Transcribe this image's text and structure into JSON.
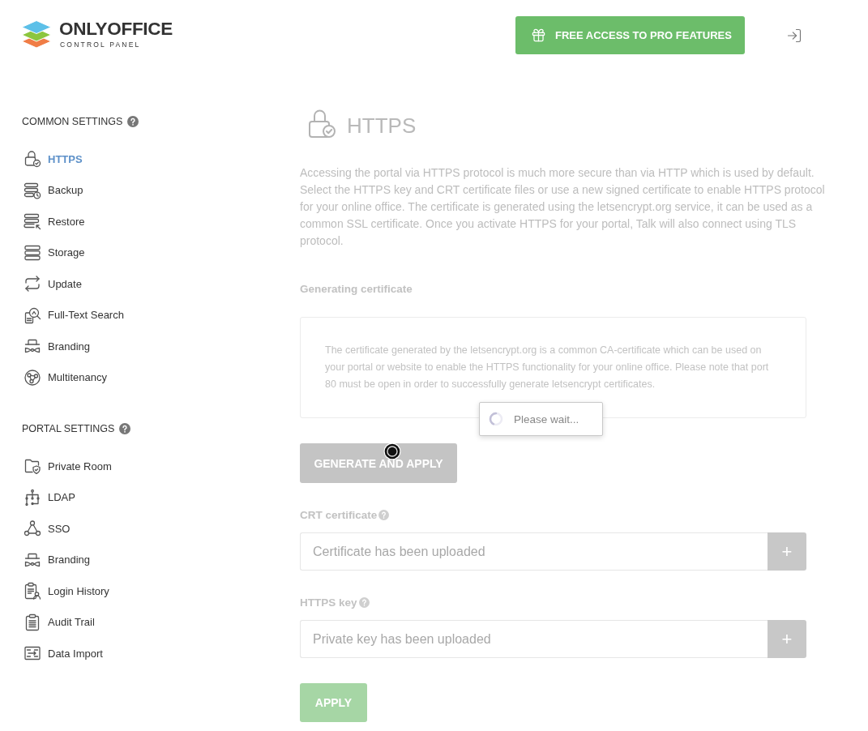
{
  "header": {
    "logo": {
      "title": "ONLYOFFICE",
      "subtitle": "CONTROL PANEL"
    },
    "promo_button": "FREE ACCESS TO PRO FEATURES"
  },
  "sidebar": {
    "sections": [
      {
        "title": "COMMON SETTINGS",
        "items": [
          {
            "label": "HTTPS",
            "selected": true
          },
          {
            "label": "Backup",
            "selected": false
          },
          {
            "label": "Restore",
            "selected": false
          },
          {
            "label": "Storage",
            "selected": false
          },
          {
            "label": "Update",
            "selected": false
          },
          {
            "label": "Full-Text Search",
            "selected": false
          },
          {
            "label": "Branding",
            "selected": false
          },
          {
            "label": "Multitenancy",
            "selected": false
          }
        ]
      },
      {
        "title": "PORTAL SETTINGS",
        "items": [
          {
            "label": "Private Room",
            "selected": false
          },
          {
            "label": "LDAP",
            "selected": false
          },
          {
            "label": "SSO",
            "selected": false
          },
          {
            "label": "Branding",
            "selected": false
          },
          {
            "label": "Login History",
            "selected": false
          },
          {
            "label": "Audit Trail",
            "selected": false
          },
          {
            "label": "Data Import",
            "selected": false
          }
        ]
      }
    ]
  },
  "main": {
    "title": "HTTPS",
    "description": "Accessing the portal via HTTPS protocol is much more secure than via HTTP which is used by default. Select the HTTPS key and CRT certificate files or use a new signed certificate to enable HTTPS protocol for your online office. The certificate is generated using the letsencrypt.org service, it can be used as a common SSL certificate. Once you activate HTTPS for your portal, Talk will also connect using TLS protocol.",
    "generate": {
      "heading": "Generating certificate",
      "note": "The certificate generated by the letsencrypt.org is a common CA-certificate which can be used on your portal or website to enable the HTTPS functionality for your online office. Please note that port 80 must be open in order to successfully generate letsencrypt certificates.",
      "button": {
        "label": "GENERATE AND APPLY",
        "disabled": true
      }
    },
    "fields": [
      {
        "label": "CRT certificate",
        "placeholder": "Certificate has been uploaded",
        "button": "+"
      },
      {
        "label": "HTTPS key",
        "placeholder": "Private key has been uploaded",
        "button": "+"
      }
    ],
    "apply_button": {
      "label": "APPLY",
      "disabled": true
    }
  },
  "loading": {
    "text": "Please wait..."
  }
}
